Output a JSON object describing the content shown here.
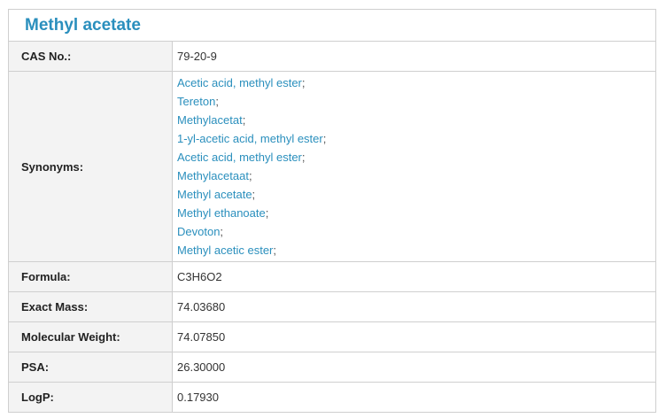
{
  "title": "Methyl acetate",
  "rows": {
    "cas": {
      "label": "CAS No.:",
      "value": "79-20-9"
    },
    "synonyms": {
      "label": "Synonyms:",
      "items": [
        "Acetic acid, methyl ester",
        "Tereton",
        "Methylacetat",
        "1-yl-acetic acid, methyl ester",
        "Acetic acid, methyl ester",
        "Methylacetaat",
        "Methyl acetate",
        "Methyl ethanoate",
        "Devoton",
        "Methyl acetic ester"
      ],
      "separator": ";"
    },
    "formula": {
      "label": "Formula:",
      "value": "C3H6O2"
    },
    "exact_mass": {
      "label": "Exact Mass:",
      "value": "74.03680"
    },
    "molecular_weight": {
      "label": "Molecular Weight:",
      "value": "74.07850"
    },
    "psa": {
      "label": "PSA:",
      "value": "26.30000"
    },
    "logp": {
      "label": "LogP:",
      "value": "0.17930"
    }
  },
  "colors": {
    "accent": "#2a8fbd",
    "border": "#cfcfcf",
    "label_bg": "#f3f3f3"
  }
}
